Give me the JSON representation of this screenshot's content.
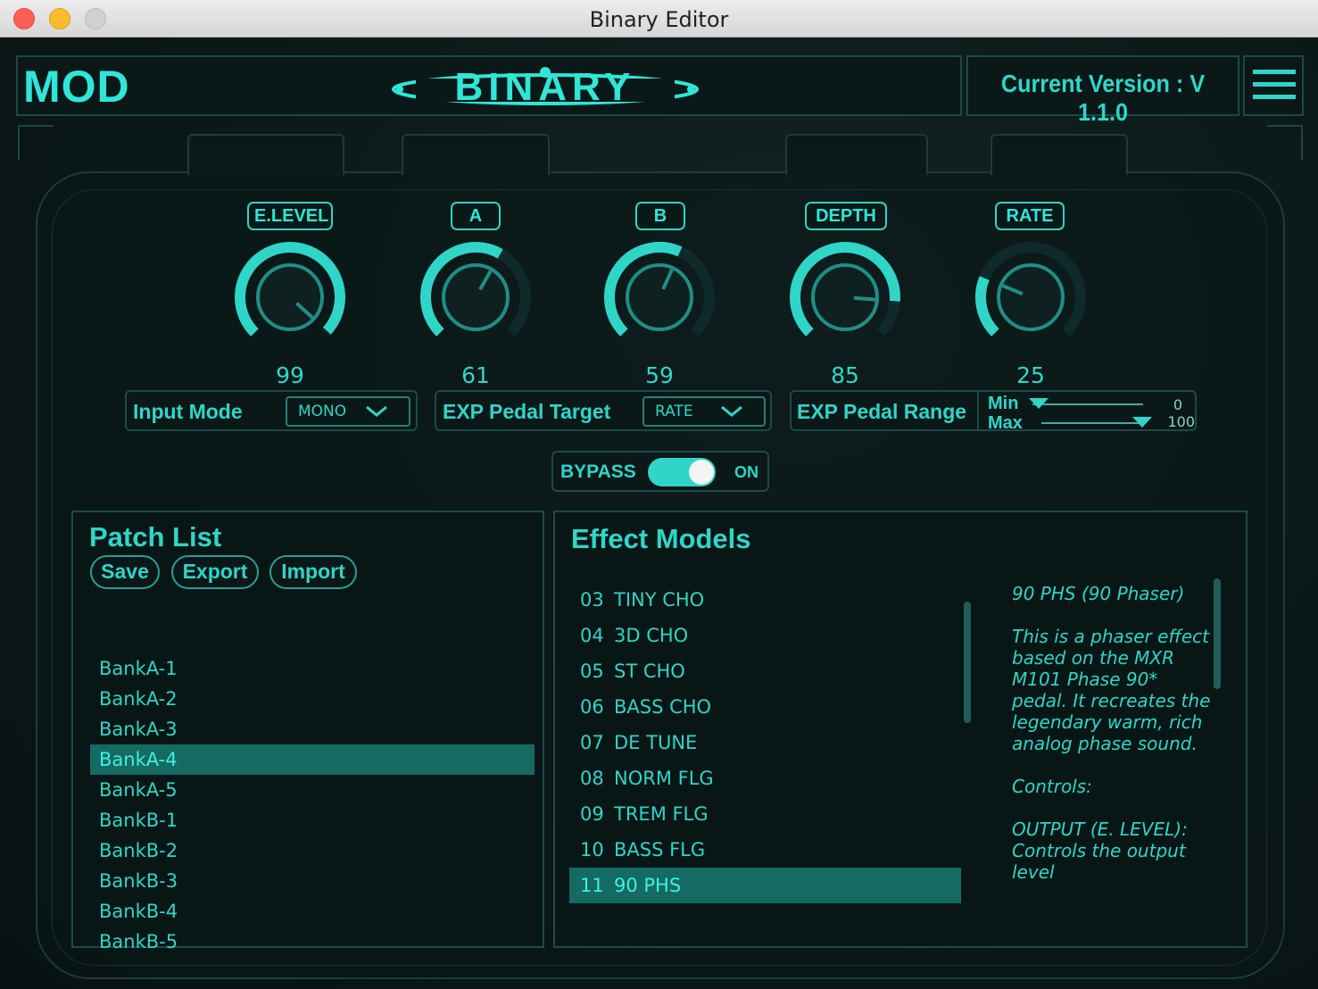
{
  "window": {
    "title": "Binary Editor"
  },
  "header": {
    "mode": "MOD",
    "brand": "BINARY",
    "version": "Current Version : V 1.1.0"
  },
  "knobs": [
    {
      "label": "E.LEVEL",
      "value": "99",
      "level": 0.99
    },
    {
      "label": "A",
      "value": "61",
      "level": 0.61
    },
    {
      "label": "B",
      "value": "59",
      "level": 0.59
    },
    {
      "label": "DEPTH",
      "value": "85",
      "level": 0.85
    },
    {
      "label": "RATE",
      "value": "25",
      "level": 0.25
    }
  ],
  "controls": {
    "input_mode": {
      "label": "Input Mode",
      "value": "MONO"
    },
    "exp_target": {
      "label": "EXP Pedal Target",
      "value": "RATE"
    },
    "exp_range": {
      "label": "EXP Pedal Range",
      "min_label": "Min",
      "max_label": "Max",
      "min_value": "0",
      "max_value": "100",
      "min_level": 0.0,
      "max_level": 1.0
    }
  },
  "bypass": {
    "label": "BYPASS",
    "state": "ON",
    "on": true
  },
  "patch_list": {
    "title": "Patch List",
    "buttons": {
      "save": "Save",
      "export": "Export",
      "import": "Import"
    },
    "items": [
      "BankA-1",
      "BankA-2",
      "BankA-3",
      "BankA-4",
      "BankA-5",
      "BankB-1",
      "BankB-2",
      "BankB-3",
      "BankB-4",
      "BankB-5"
    ],
    "selected_index": 3
  },
  "effect_models": {
    "title": "Effect Models",
    "items": [
      {
        "num": "03",
        "name": "TINY CHO"
      },
      {
        "num": "04",
        "name": "3D CHO"
      },
      {
        "num": "05",
        "name": "ST CHO"
      },
      {
        "num": "06",
        "name": "BASS CHO"
      },
      {
        "num": "07",
        "name": "DE TUNE"
      },
      {
        "num": "08",
        "name": "NORM FLG"
      },
      {
        "num": "09",
        "name": "TREM FLG"
      },
      {
        "num": "10",
        "name": "BASS FLG"
      },
      {
        "num": "11",
        "name": "90 PHS"
      }
    ],
    "selected_index": 8,
    "description": {
      "title": "90 PHS (90 Phaser)",
      "body": "This is a phaser effect based on the MXR M101 Phase 90* pedal. It recreates the legendary warm, rich analog phase sound.",
      "controls_heading": "Controls:",
      "control_detail": "OUTPUT (E. LEVEL): Controls the output level"
    }
  },
  "colors": {
    "accent": "#2fd6c8",
    "selected": "#156a64",
    "background": "#0b1616",
    "border": "#1d4a47"
  }
}
